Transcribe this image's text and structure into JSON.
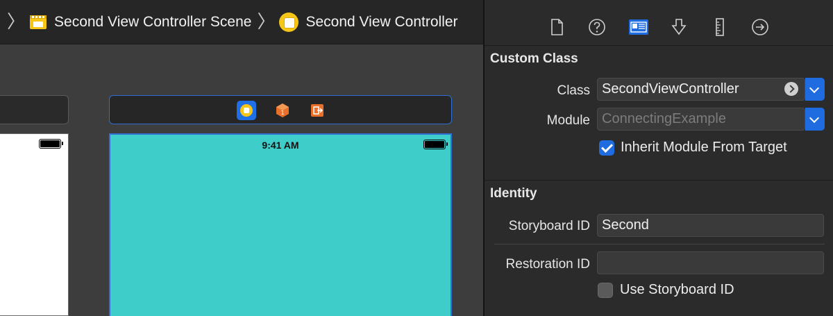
{
  "jump_bar": {
    "scene_label": "Second View Controller Scene",
    "controller_label": "Second View Controller"
  },
  "canvas": {
    "status_time": "9:41 AM",
    "scene_background_color": "#3ecdc9"
  },
  "inspector": {
    "tabs": [
      {
        "name": "file-inspector",
        "icon": "document-icon"
      },
      {
        "name": "quick-help",
        "icon": "question-icon"
      },
      {
        "name": "identity-inspector",
        "icon": "identity-card-icon",
        "selected": true
      },
      {
        "name": "attributes-inspector",
        "icon": "arrow-down-icon"
      },
      {
        "name": "size-inspector",
        "icon": "ruler-icon"
      },
      {
        "name": "connections-inspector",
        "icon": "arrow-right-circle-icon"
      }
    ],
    "custom_class": {
      "title": "Custom Class",
      "class_label": "Class",
      "class_value": "SecondViewController",
      "module_label": "Module",
      "module_placeholder": "ConnectingExample",
      "inherit_label": "Inherit Module From Target",
      "inherit_checked": true
    },
    "identity": {
      "title": "Identity",
      "storyboard_id_label": "Storyboard ID",
      "storyboard_id_value": "Second",
      "restoration_id_label": "Restoration ID",
      "restoration_id_value": "",
      "use_storyboard_label": "Use Storyboard ID",
      "use_storyboard_checked": false
    }
  }
}
